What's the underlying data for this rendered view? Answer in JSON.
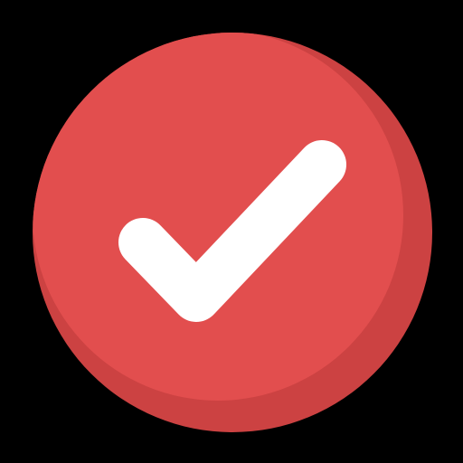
{
  "icon": {
    "name": "check-circle-icon",
    "background_color": "#000000",
    "circle_color": "#E24E4E",
    "shadow_color": "#CC4242",
    "check_color": "#FFFFFF"
  }
}
